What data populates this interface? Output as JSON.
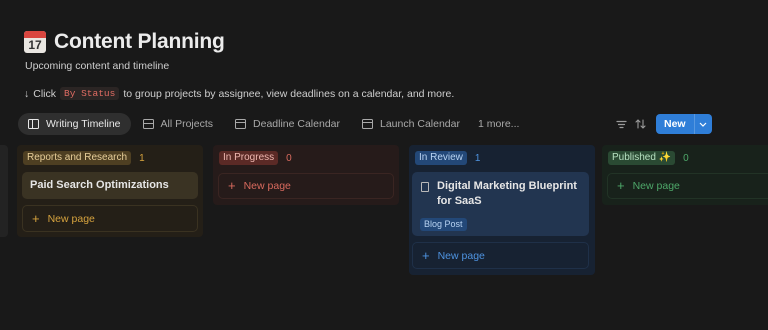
{
  "page": {
    "icon": "calendar-icon",
    "icon_day": "17",
    "title": "Content Planning",
    "subtitle": "Upcoming content and timeline",
    "hint": {
      "arrow": "↓",
      "click": "Click",
      "code": "By Status",
      "rest": "to group projects by assignee, view deadlines on a calendar, and more."
    }
  },
  "tabs": [
    {
      "label": "Writing Timeline",
      "icon": "timeline-icon",
      "active": true
    },
    {
      "label": "All Projects",
      "icon": "table-icon"
    },
    {
      "label": "Deadline Calendar",
      "icon": "calendar-icon"
    },
    {
      "label": "Launch Calendar",
      "icon": "calendar-icon"
    }
  ],
  "more_label": "1 more...",
  "toolbar": {
    "icons": [
      "filter-icon",
      "sort-icon",
      "automation-icon",
      "search-icon",
      "settings-icon"
    ],
    "new_label": "New"
  },
  "columns": [
    {
      "name": "Reports and Research",
      "count": "1",
      "cards": [
        {
          "title": "Paid Search Optimizations"
        }
      ]
    },
    {
      "name": "In Progress",
      "count": "0",
      "cards": []
    },
    {
      "name": "In Review",
      "count": "1",
      "cards": [
        {
          "title": "Digital Marketing Blueprint for SaaS",
          "tag": "Blog Post"
        }
      ]
    },
    {
      "name": "Published ✨",
      "count": "0",
      "cards": []
    }
  ],
  "new_page_label": "New page",
  "colors": {
    "accent": "#2f7ed8",
    "background": "#191919"
  }
}
